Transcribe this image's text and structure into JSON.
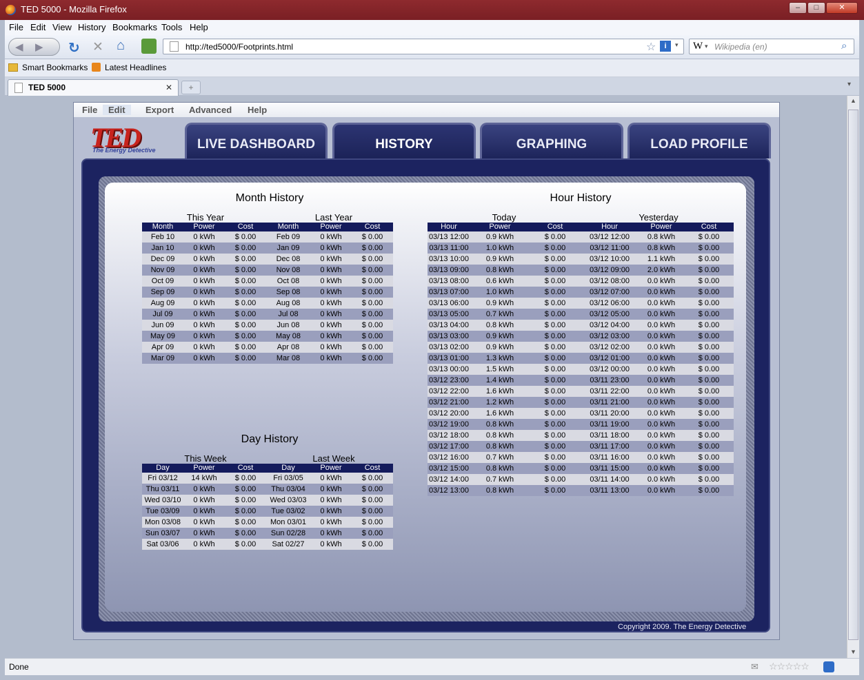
{
  "window": {
    "title": "TED 5000 - Mozilla Firefox",
    "min": "–",
    "max": "□",
    "close": "✕"
  },
  "menubar": [
    "File",
    "Edit",
    "View",
    "History",
    "Bookmarks",
    "Tools",
    "Help"
  ],
  "nav": {
    "url": "http://ted5000/Footprints.html",
    "search_placeholder": "Wikipedia (en)",
    "search_engine": "W"
  },
  "bookmarks": [
    "Smart Bookmarks",
    "Latest Headlines"
  ],
  "tab": {
    "title": "TED 5000",
    "close": "✕",
    "new": "+"
  },
  "status": "Done",
  "app": {
    "menu": [
      "File",
      "Edit",
      "Export",
      "Advanced",
      "Help"
    ],
    "logo": "TED",
    "logo_sub": "The Energy Detective",
    "tabs": [
      "LIVE DASHBOARD",
      "HISTORY",
      "GRAPHING",
      "LOAD PROFILE"
    ],
    "copyright": "Copyright 2009. The Energy Detective"
  },
  "month": {
    "title": "Month History",
    "this_label": "This Year",
    "last_label": "Last Year",
    "headers": [
      "Month",
      "Power",
      "Cost",
      "Month",
      "Power",
      "Cost"
    ],
    "rows": [
      [
        "Feb 10",
        "0 kWh",
        "$ 0.00",
        "Feb 09",
        "0 kWh",
        "$ 0.00"
      ],
      [
        "Jan 10",
        "0 kWh",
        "$ 0.00",
        "Jan 09",
        "0 kWh",
        "$ 0.00"
      ],
      [
        "Dec 09",
        "0 kWh",
        "$ 0.00",
        "Dec 08",
        "0 kWh",
        "$ 0.00"
      ],
      [
        "Nov 09",
        "0 kWh",
        "$ 0.00",
        "Nov 08",
        "0 kWh",
        "$ 0.00"
      ],
      [
        "Oct 09",
        "0 kWh",
        "$ 0.00",
        "Oct 08",
        "0 kWh",
        "$ 0.00"
      ],
      [
        "Sep 09",
        "0 kWh",
        "$ 0.00",
        "Sep 08",
        "0 kWh",
        "$ 0.00"
      ],
      [
        "Aug 09",
        "0 kWh",
        "$ 0.00",
        "Aug 08",
        "0 kWh",
        "$ 0.00"
      ],
      [
        "Jul 09",
        "0 kWh",
        "$ 0.00",
        "Jul 08",
        "0 kWh",
        "$ 0.00"
      ],
      [
        "Jun 09",
        "0 kWh",
        "$ 0.00",
        "Jun 08",
        "0 kWh",
        "$ 0.00"
      ],
      [
        "May 09",
        "0 kWh",
        "$ 0.00",
        "May 08",
        "0 kWh",
        "$ 0.00"
      ],
      [
        "Apr 09",
        "0 kWh",
        "$ 0.00",
        "Apr 08",
        "0 kWh",
        "$ 0.00"
      ],
      [
        "Mar 09",
        "0 kWh",
        "$ 0.00",
        "Mar 08",
        "0 kWh",
        "$ 0.00"
      ]
    ]
  },
  "day": {
    "title": "Day History",
    "this_label": "This Week",
    "last_label": "Last Week",
    "headers": [
      "Day",
      "Power",
      "Cost",
      "Day",
      "Power",
      "Cost"
    ],
    "rows": [
      [
        "Fri 03/12",
        "14 kWh",
        "$ 0.00",
        "Fri 03/05",
        "0 kWh",
        "$ 0.00"
      ],
      [
        "Thu 03/11",
        "0 kWh",
        "$ 0.00",
        "Thu 03/04",
        "0 kWh",
        "$ 0.00"
      ],
      [
        "Wed 03/10",
        "0 kWh",
        "$ 0.00",
        "Wed 03/03",
        "0 kWh",
        "$ 0.00"
      ],
      [
        "Tue 03/09",
        "0 kWh",
        "$ 0.00",
        "Tue 03/02",
        "0 kWh",
        "$ 0.00"
      ],
      [
        "Mon 03/08",
        "0 kWh",
        "$ 0.00",
        "Mon 03/01",
        "0 kWh",
        "$ 0.00"
      ],
      [
        "Sun 03/07",
        "0 kWh",
        "$ 0.00",
        "Sun 02/28",
        "0 kWh",
        "$ 0.00"
      ],
      [
        "Sat 03/06",
        "0 kWh",
        "$ 0.00",
        "Sat 02/27",
        "0 kWh",
        "$ 0.00"
      ]
    ]
  },
  "hour": {
    "title": "Hour History",
    "this_label": "Today",
    "last_label": "Yesterday",
    "headers": [
      "Hour",
      "Power",
      "Cost",
      "Hour",
      "Power",
      "Cost"
    ],
    "rows": [
      [
        "03/13 12:00",
        "0.9 kWh",
        "$ 0.00",
        "03/12 12:00",
        "0.8 kWh",
        "$ 0.00"
      ],
      [
        "03/13 11:00",
        "1.0 kWh",
        "$ 0.00",
        "03/12 11:00",
        "0.8 kWh",
        "$ 0.00"
      ],
      [
        "03/13 10:00",
        "0.9 kWh",
        "$ 0.00",
        "03/12 10:00",
        "1.1 kWh",
        "$ 0.00"
      ],
      [
        "03/13 09:00",
        "0.8 kWh",
        "$ 0.00",
        "03/12 09:00",
        "2.0 kWh",
        "$ 0.00"
      ],
      [
        "03/13 08:00",
        "0.6 kWh",
        "$ 0.00",
        "03/12 08:00",
        "0.0 kWh",
        "$ 0.00"
      ],
      [
        "03/13 07:00",
        "1.0 kWh",
        "$ 0.00",
        "03/12 07:00",
        "0.0 kWh",
        "$ 0.00"
      ],
      [
        "03/13 06:00",
        "0.9 kWh",
        "$ 0.00",
        "03/12 06:00",
        "0.0 kWh",
        "$ 0.00"
      ],
      [
        "03/13 05:00",
        "0.7 kWh",
        "$ 0.00",
        "03/12 05:00",
        "0.0 kWh",
        "$ 0.00"
      ],
      [
        "03/13 04:00",
        "0.8 kWh",
        "$ 0.00",
        "03/12 04:00",
        "0.0 kWh",
        "$ 0.00"
      ],
      [
        "03/13 03:00",
        "0.9 kWh",
        "$ 0.00",
        "03/12 03:00",
        "0.0 kWh",
        "$ 0.00"
      ],
      [
        "03/13 02:00",
        "0.9 kWh",
        "$ 0.00",
        "03/12 02:00",
        "0.0 kWh",
        "$ 0.00"
      ],
      [
        "03/13 01:00",
        "1.3 kWh",
        "$ 0.00",
        "03/12 01:00",
        "0.0 kWh",
        "$ 0.00"
      ],
      [
        "03/13 00:00",
        "1.5 kWh",
        "$ 0.00",
        "03/12 00:00",
        "0.0 kWh",
        "$ 0.00"
      ],
      [
        "03/12 23:00",
        "1.4 kWh",
        "$ 0.00",
        "03/11 23:00",
        "0.0 kWh",
        "$ 0.00"
      ],
      [
        "03/12 22:00",
        "1.6 kWh",
        "$ 0.00",
        "03/11 22:00",
        "0.0 kWh",
        "$ 0.00"
      ],
      [
        "03/12 21:00",
        "1.2 kWh",
        "$ 0.00",
        "03/11 21:00",
        "0.0 kWh",
        "$ 0.00"
      ],
      [
        "03/12 20:00",
        "1.6 kWh",
        "$ 0.00",
        "03/11 20:00",
        "0.0 kWh",
        "$ 0.00"
      ],
      [
        "03/12 19:00",
        "0.8 kWh",
        "$ 0.00",
        "03/11 19:00",
        "0.0 kWh",
        "$ 0.00"
      ],
      [
        "03/12 18:00",
        "0.8 kWh",
        "$ 0.00",
        "03/11 18:00",
        "0.0 kWh",
        "$ 0.00"
      ],
      [
        "03/12 17:00",
        "0.8 kWh",
        "$ 0.00",
        "03/11 17:00",
        "0.0 kWh",
        "$ 0.00"
      ],
      [
        "03/12 16:00",
        "0.7 kWh",
        "$ 0.00",
        "03/11 16:00",
        "0.0 kWh",
        "$ 0.00"
      ],
      [
        "03/12 15:00",
        "0.8 kWh",
        "$ 0.00",
        "03/11 15:00",
        "0.0 kWh",
        "$ 0.00"
      ],
      [
        "03/12 14:00",
        "0.7 kWh",
        "$ 0.00",
        "03/11 14:00",
        "0.0 kWh",
        "$ 0.00"
      ],
      [
        "03/12 13:00",
        "0.8 kWh",
        "$ 0.00",
        "03/11 13:00",
        "0.0 kWh",
        "$ 0.00"
      ]
    ]
  }
}
